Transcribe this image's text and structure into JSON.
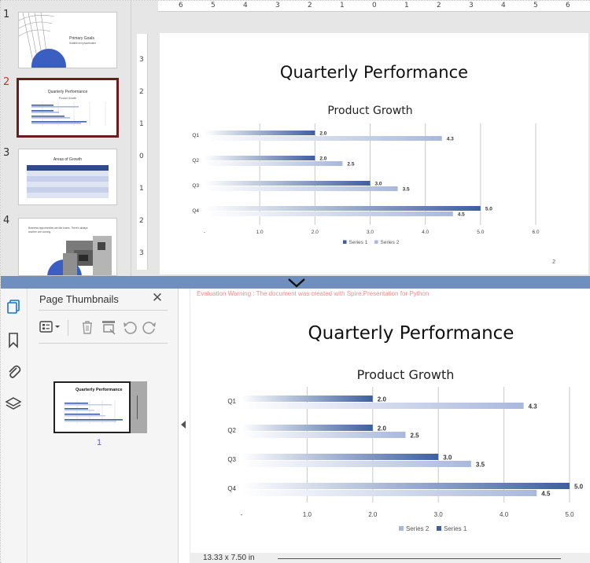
{
  "editor": {
    "slide_thumbnails": [
      {
        "number": "1",
        "title": "Primary Goals",
        "subtitle": "Subtitle text placeholder"
      },
      {
        "number": "2",
        "title": "Quarterly Performance",
        "subtitle": "Product Growth"
      },
      {
        "number": "3",
        "title": "Areas of Growth",
        "subtitle": ""
      },
      {
        "number": "4",
        "title": "",
        "subtitle": "Business opportunities are like buses. There's always another one coming."
      }
    ],
    "h_ruler_labels": [
      "6",
      "5",
      "4",
      "3",
      "2",
      "1",
      "0",
      "1",
      "2",
      "3",
      "4",
      "5",
      "6"
    ],
    "v_ruler_labels": [
      "3",
      "2",
      "1",
      "0",
      "1",
      "2",
      "3"
    ],
    "slide": {
      "title": "Quarterly Performance",
      "page_number": "2"
    }
  },
  "viewer": {
    "panel_title": "Page Thumbnails",
    "page_label": "1",
    "watermark": "Evaluation Warning : The document was created with Spire.Presentation for Python",
    "page_size": "13.33 x 7.50 in",
    "page_title": "Quarterly Performance"
  },
  "colors": {
    "series1": "#3d5fa0",
    "series2": "#a9b8dc",
    "accent_red": "#c0392b",
    "divider": "#6f8fbe"
  },
  "chart_data": [
    {
      "type": "bar",
      "title": "Product Growth",
      "categories": [
        "Q1",
        "Q2",
        "Q3",
        "Q4"
      ],
      "series": [
        {
          "name": "Series 1",
          "values": [
            2.0,
            2.0,
            3.0,
            5.0
          ]
        },
        {
          "name": "Series 2",
          "values": [
            4.3,
            2.5,
            3.5,
            4.5
          ]
        }
      ],
      "x_ticks": [
        "-",
        "1.0",
        "2.0",
        "3.0",
        "4.0",
        "5.0",
        "6.0"
      ],
      "xlim": [
        0,
        6
      ],
      "grid": true,
      "legend": "bottom",
      "legend_order": [
        "Series 1",
        "Series 2"
      ]
    },
    {
      "type": "bar",
      "title": "Product Growth",
      "categories": [
        "Q1",
        "Q2",
        "Q3",
        "Q4"
      ],
      "series": [
        {
          "name": "Series 1",
          "values": [
            2.0,
            2.0,
            3.0,
            5.0
          ]
        },
        {
          "name": "Series 2",
          "values": [
            4.3,
            2.5,
            3.5,
            4.5
          ]
        }
      ],
      "x_ticks": [
        "-",
        "1.0",
        "2.0",
        "3.0",
        "4.0",
        "5.0"
      ],
      "xlim": [
        0,
        5
      ],
      "grid": true,
      "legend": "bottom",
      "legend_order": [
        "Series 2",
        "Series 1"
      ]
    }
  ]
}
